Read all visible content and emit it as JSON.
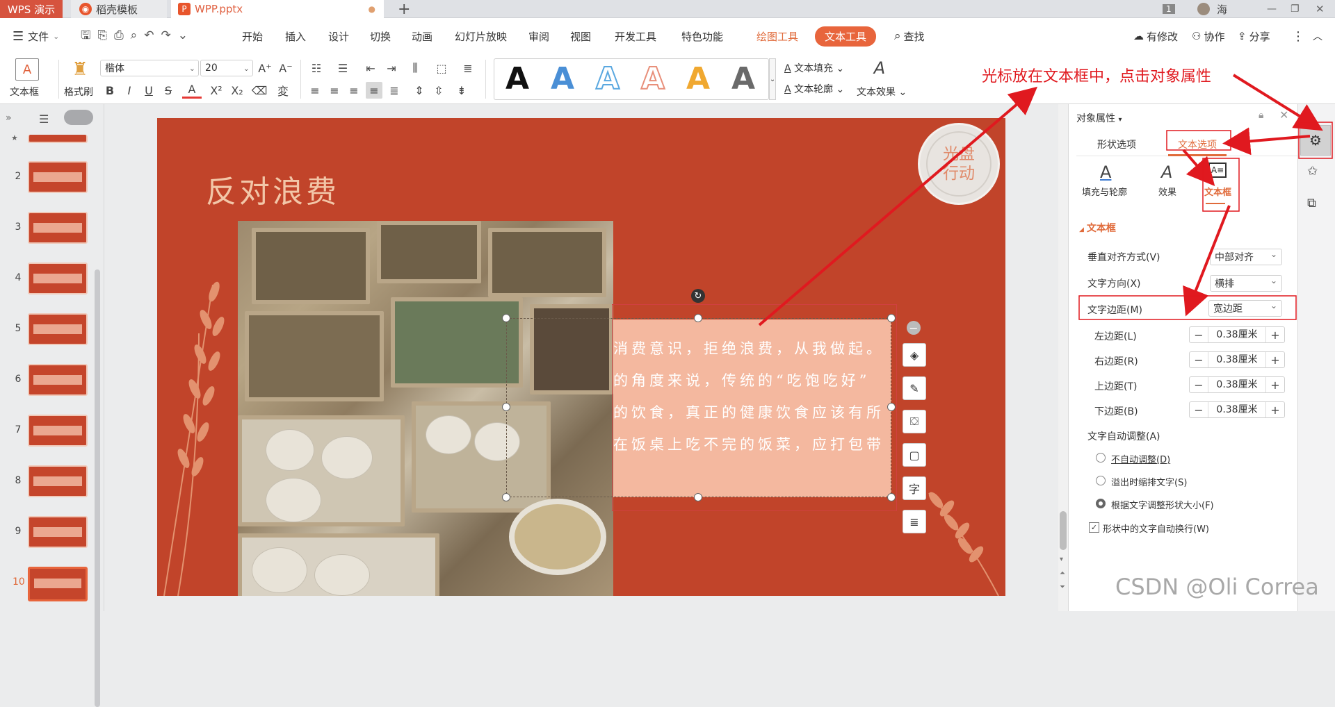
{
  "tabs": {
    "app": "WPS 演示",
    "template": "稻壳模板",
    "file": "WPP.pptx",
    "add": "+"
  },
  "window": {
    "page_badge": "1",
    "user": "海"
  },
  "menu": {
    "file": "文件",
    "items": [
      "开始",
      "插入",
      "设计",
      "切换",
      "动画",
      "幻灯片放映",
      "审阅",
      "视图",
      "开发工具",
      "特色功能"
    ],
    "drawing_tools": "绘图工具",
    "text_tools": "文本工具",
    "search": "查找",
    "right": [
      "有修改",
      "协作",
      "分享"
    ]
  },
  "ribbon": {
    "textbox": "文本框",
    "format_painter": "格式刷",
    "font_name": "楷体",
    "font_size": "20",
    "text_fill": "文本填充",
    "text_outline": "文本轮廓",
    "text_effect": "文本效果",
    "style_letter": "A",
    "style_colors": [
      "#111111",
      "#4a8fd6",
      "#5aa8e0",
      "#e88f7a",
      "#f0a830",
      "#6a6a6a"
    ]
  },
  "thumbnails": [
    "2",
    "3",
    "4",
    "5",
    "6",
    "7",
    "8",
    "9",
    "10"
  ],
  "slide": {
    "title": "反对浪费",
    "seal": "光盘\n行动",
    "seal_line1": "光盘",
    "seal_line2": "行动",
    "lines": [
      "消费意识，拒绝浪费，从我做起。",
      "的角度来说，传统的“吃饱吃好”",
      "的饮食，真正的健康饮食应该有所",
      "在饭桌上吃不完的饭菜，应打包带"
    ]
  },
  "panel": {
    "title": "对象属性",
    "tabs": [
      "形状选项",
      "文本选项"
    ],
    "subtabs": [
      "填充与轮廓",
      "效果",
      "文本框"
    ],
    "section": "文本框",
    "rows": [
      {
        "label": "垂直对齐方式(V)",
        "value": "中部对齐"
      },
      {
        "label": "文字方向(X)",
        "value": "横排"
      },
      {
        "label": "文字边距(M)",
        "value": "宽边距"
      }
    ],
    "margins": [
      {
        "label": "左边距(L)",
        "value": "0.38厘米"
      },
      {
        "label": "右边距(R)",
        "value": "0.38厘米"
      },
      {
        "label": "上边距(T)",
        "value": "0.38厘米"
      },
      {
        "label": "下边距(B)",
        "value": "0.38厘米"
      }
    ],
    "autofit_label": "文字自动调整(A)",
    "autofit_options": [
      "不自动调整(D)",
      "溢出时缩排文字(S)",
      "根据文字调整形状大小(F)"
    ],
    "wrap_label": "形状中的文字自动换行(W)"
  },
  "annotation": "光标放在文本框中，点击对象属性",
  "watermark": "CSDN @Oli Correa"
}
